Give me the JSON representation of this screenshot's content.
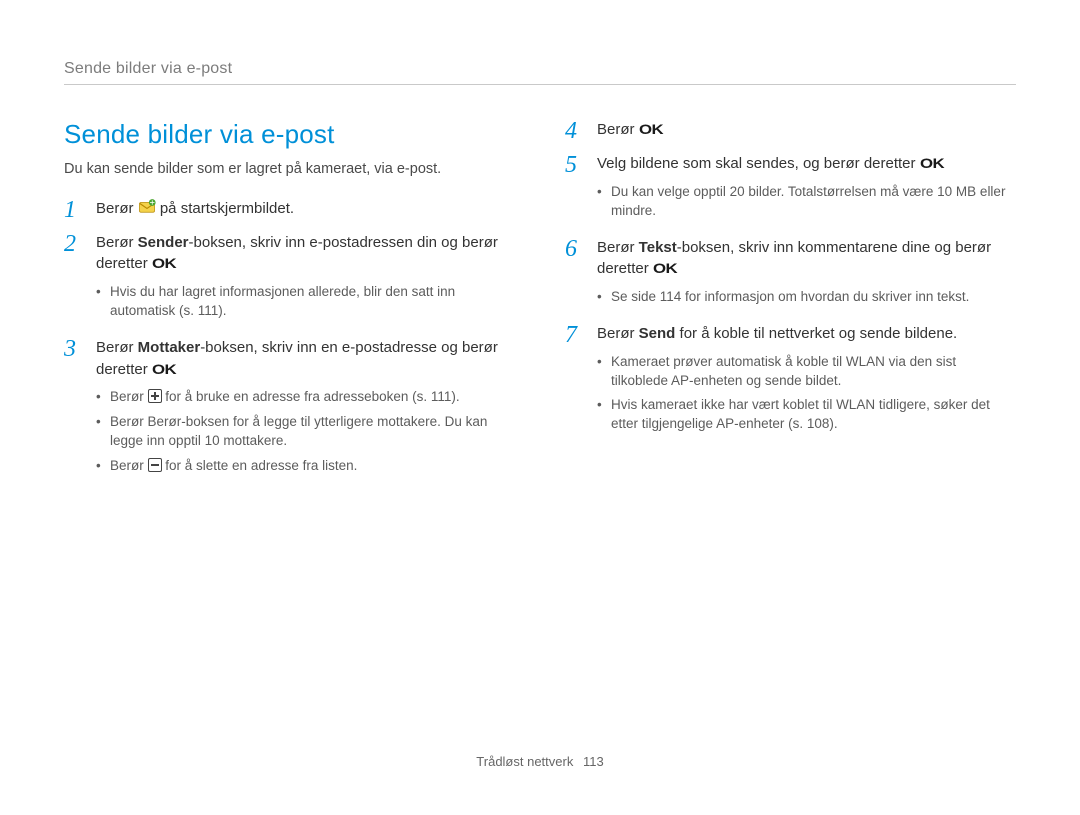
{
  "running_header": "Sende bilder via e-post",
  "title": "Sende bilder via e-post",
  "intro": "Du kan sende bilder som er lagret på kameraet, via e-post.",
  "icons": {
    "ok": "OK",
    "email_app": "email-icon",
    "plus": "+",
    "minus": "−"
  },
  "left_steps": [
    {
      "num": "1",
      "pre": "Berør ",
      "icon": "email-app",
      "post": " på startskjermbildet."
    },
    {
      "num": "2",
      "pre": "Berør ",
      "bold": "Sender",
      "mid": "-boksen, skriv inn e-postadressen din og berør deretter ",
      "icon": "ok",
      "post": ".",
      "bullets": [
        "Hvis du har lagret informasjonen allerede, blir den satt inn automatisk (s. 111)."
      ]
    },
    {
      "num": "3",
      "pre": "Berør ",
      "bold": "Mottaker",
      "mid": "-boksen, skriv inn en e-postadresse og berør deretter ",
      "icon": "ok",
      "post": ".",
      "bullets": [
        {
          "pre": "Berør ",
          "icon": "plus",
          "post": " for å bruke en adresse fra adresseboken (s. 111)."
        },
        {
          "pre": "Berør ",
          "bold": "Berør",
          "post": "-boksen for å legge til ytterligere mottakere. Du kan legge inn opptil 10 mottakere."
        },
        {
          "pre": "Berør ",
          "icon": "minus",
          "post": " for å slette en adresse fra listen."
        }
      ]
    }
  ],
  "right_steps": [
    {
      "num": "4",
      "pre": "Berør ",
      "icon": "ok",
      "post": "."
    },
    {
      "num": "5",
      "pre": "Velg bildene som skal sendes, og berør deretter ",
      "icon": "ok",
      "post": ".",
      "bullets": [
        "Du kan velge opptil 20 bilder. Totalstørrelsen må være 10 MB eller mindre."
      ]
    },
    {
      "num": "6",
      "pre": "Berør ",
      "bold": "Tekst",
      "mid": "-boksen, skriv inn kommentarene dine og berør deretter ",
      "icon": "ok",
      "post": ".",
      "bullets": [
        "Se side 114 for informasjon om hvordan du skriver inn tekst."
      ]
    },
    {
      "num": "7",
      "pre": "Berør ",
      "bold": "Send",
      "post": " for å koble til nettverket og sende bildene.",
      "bullets": [
        "Kameraet prøver automatisk å koble til WLAN via den sist tilkoblede AP-enheten og sende bildet.",
        "Hvis kameraet ikke har vært koblet til WLAN tidligere, søker det etter tilgjengelige AP-enheter (s. 108)."
      ]
    }
  ],
  "footer_section": "Trådløst nettverk",
  "footer_page": "113"
}
